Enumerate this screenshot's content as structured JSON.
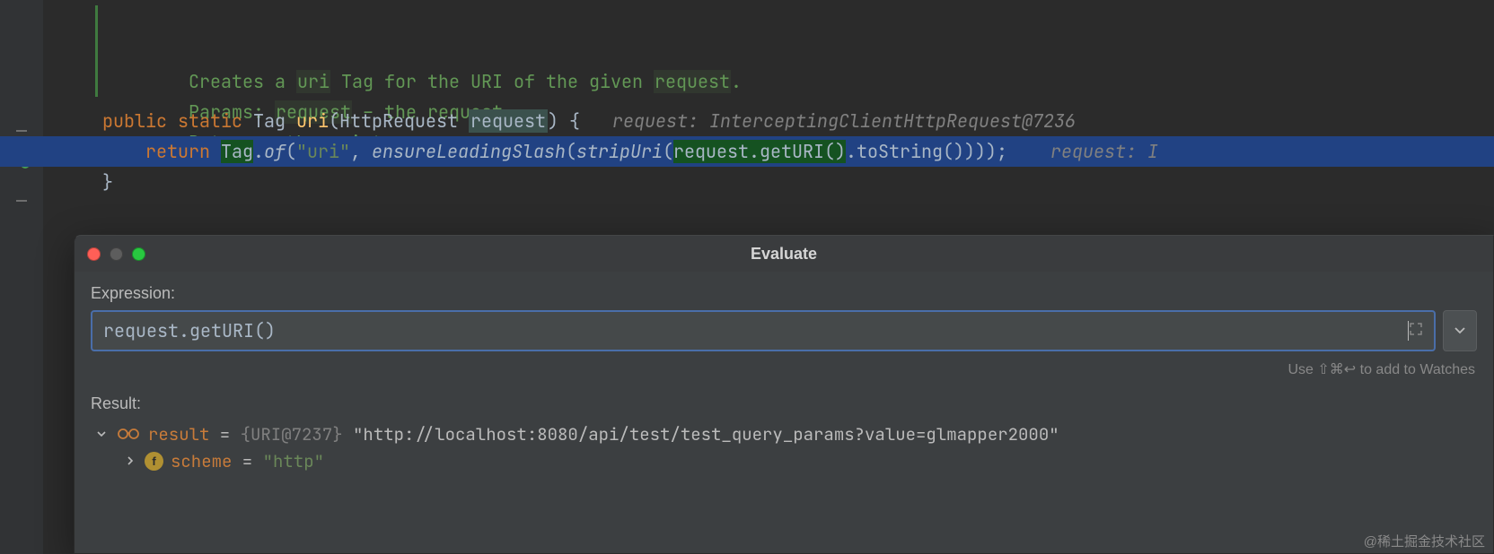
{
  "editor": {
    "javadoc": {
      "l1_a": "Creates a ",
      "l1_b": "uri",
      "l1_c": " Tag for the URI of the given ",
      "l1_d": "request",
      "l1_e": ".",
      "l2_a": "Params: ",
      "l2_b": "request",
      "l2_c": " – the request",
      "l3": "Returns: the uri tag"
    },
    "sig": {
      "kw_public": "public",
      "kw_static": "static",
      "type_tag": "Tag",
      "name": "uri",
      "lp": "(",
      "ptype": "HttpRequest",
      "pname": "request",
      "rp": ")",
      "brace": " {",
      "inlay": "request: InterceptingClientHttpRequest@7236"
    },
    "ret": {
      "kw_return": "return",
      "tag": "Tag",
      "dot1": ".",
      "of": "of",
      "lp": "(",
      "str": "\"uri\"",
      "comma": ", ",
      "ensure": "ensureLeadingSlash",
      "lp2": "(",
      "strip": "stripUri",
      "lp3": "(",
      "req": "request",
      "dot2": ".",
      "getURI": "getURI",
      "pp": "()",
      "dot3": ".",
      "toStr": "toString",
      "pp2": "()",
      "close": ")));",
      "inlay": "request: I"
    },
    "close_brace": "}"
  },
  "dialog": {
    "title": "Evaluate",
    "expr_label": "Expression:",
    "expression": "request.getURI()",
    "hint": "Use ⇧⌘↩ to add to Watches",
    "result_label": "Result:",
    "tree": {
      "root": {
        "name": "result",
        "eq": " = ",
        "meta": "{URI@7237}",
        "val": " \"http://localhost:8080/api/test/test_query_params?value=glmapper2000\""
      },
      "scheme": {
        "badge": "f",
        "name": "scheme",
        "eq": " = ",
        "val": "\"http\""
      }
    }
  },
  "watermark": "@稀土掘金技术社区"
}
